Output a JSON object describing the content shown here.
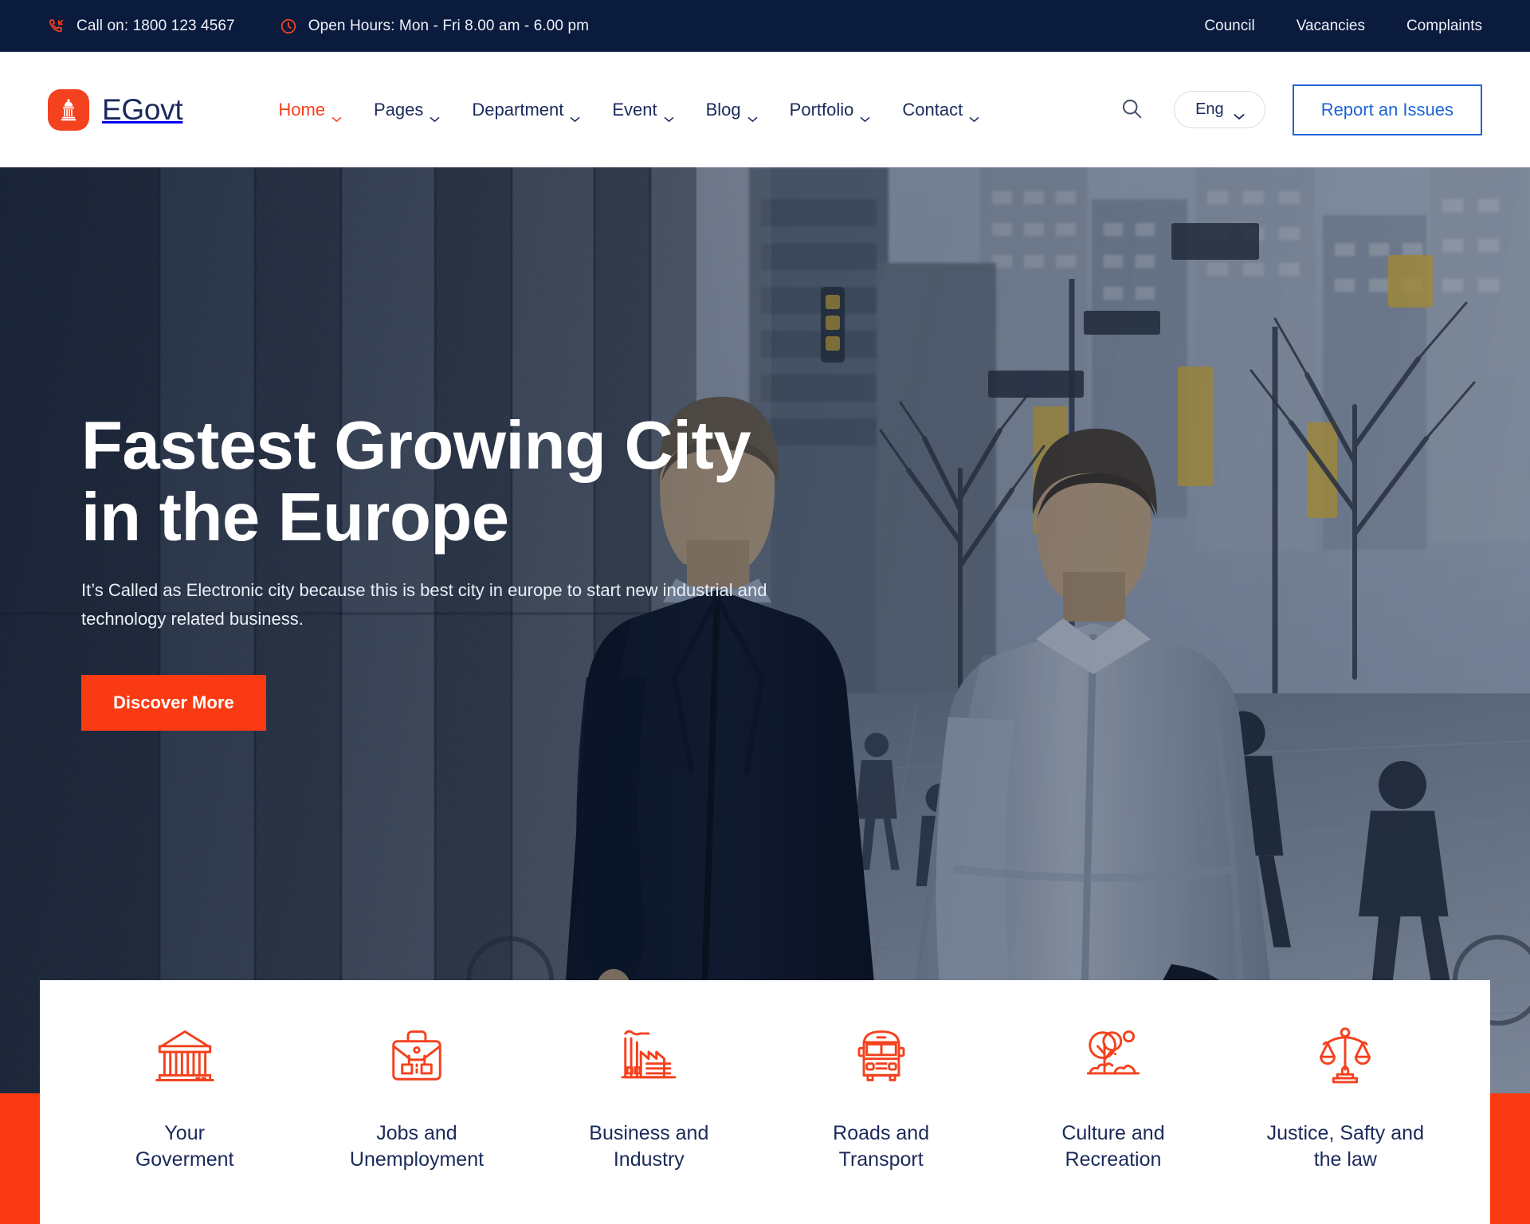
{
  "topbar": {
    "phone": {
      "icon": "phone-incoming-icon",
      "text": "Call on: 1800 123 4567"
    },
    "hours": {
      "icon": "clock-icon",
      "text": "Open Hours: Mon - Fri 8.00 am - 6.00 pm"
    },
    "links": [
      {
        "label": "Council"
      },
      {
        "label": "Vacancies"
      },
      {
        "label": "Complaints"
      }
    ]
  },
  "nav": {
    "brand": {
      "name": "EGovt",
      "icon": "capitol-building-icon",
      "color": "#f4411e"
    },
    "menu": [
      {
        "label": "Home",
        "active": true,
        "caret": true
      },
      {
        "label": "Pages",
        "active": false,
        "caret": true
      },
      {
        "label": "Department",
        "active": false,
        "caret": true
      },
      {
        "label": "Event",
        "active": false,
        "caret": true
      },
      {
        "label": "Blog",
        "active": false,
        "caret": true
      },
      {
        "label": "Portfolio",
        "active": false,
        "caret": true
      },
      {
        "label": "Contact",
        "active": false,
        "caret": true
      }
    ],
    "search_icon": "search-icon",
    "language": {
      "value": "Eng",
      "caret_icon": "chevron-down-icon"
    },
    "report_button": {
      "label": "Report an Issues",
      "color": "#1f63d6"
    }
  },
  "hero": {
    "title_line1": "Fastest Growing City",
    "title_line2": "in the Europe",
    "subtitle": "It’s Called as Electronic city because this is best city in europe to start new industrial and technology related business.",
    "cta": {
      "label": "Discover More",
      "color": "#f93a13"
    }
  },
  "services": {
    "items": [
      {
        "label": "Your\nGoverment",
        "icon": "bank-building-icon"
      },
      {
        "label": "Jobs and\nUnemployment",
        "icon": "briefcase-icon"
      },
      {
        "label": "Business and\nIndustry",
        "icon": "factory-icon"
      },
      {
        "label": "Roads and\nTransport",
        "icon": "bus-icon"
      },
      {
        "label": "Culture and\nRecreation",
        "icon": "tree-park-icon"
      },
      {
        "label": "Justice, Safty and\nthe law",
        "icon": "scales-of-justice-icon"
      }
    ],
    "accent_color": "#f4411e"
  }
}
